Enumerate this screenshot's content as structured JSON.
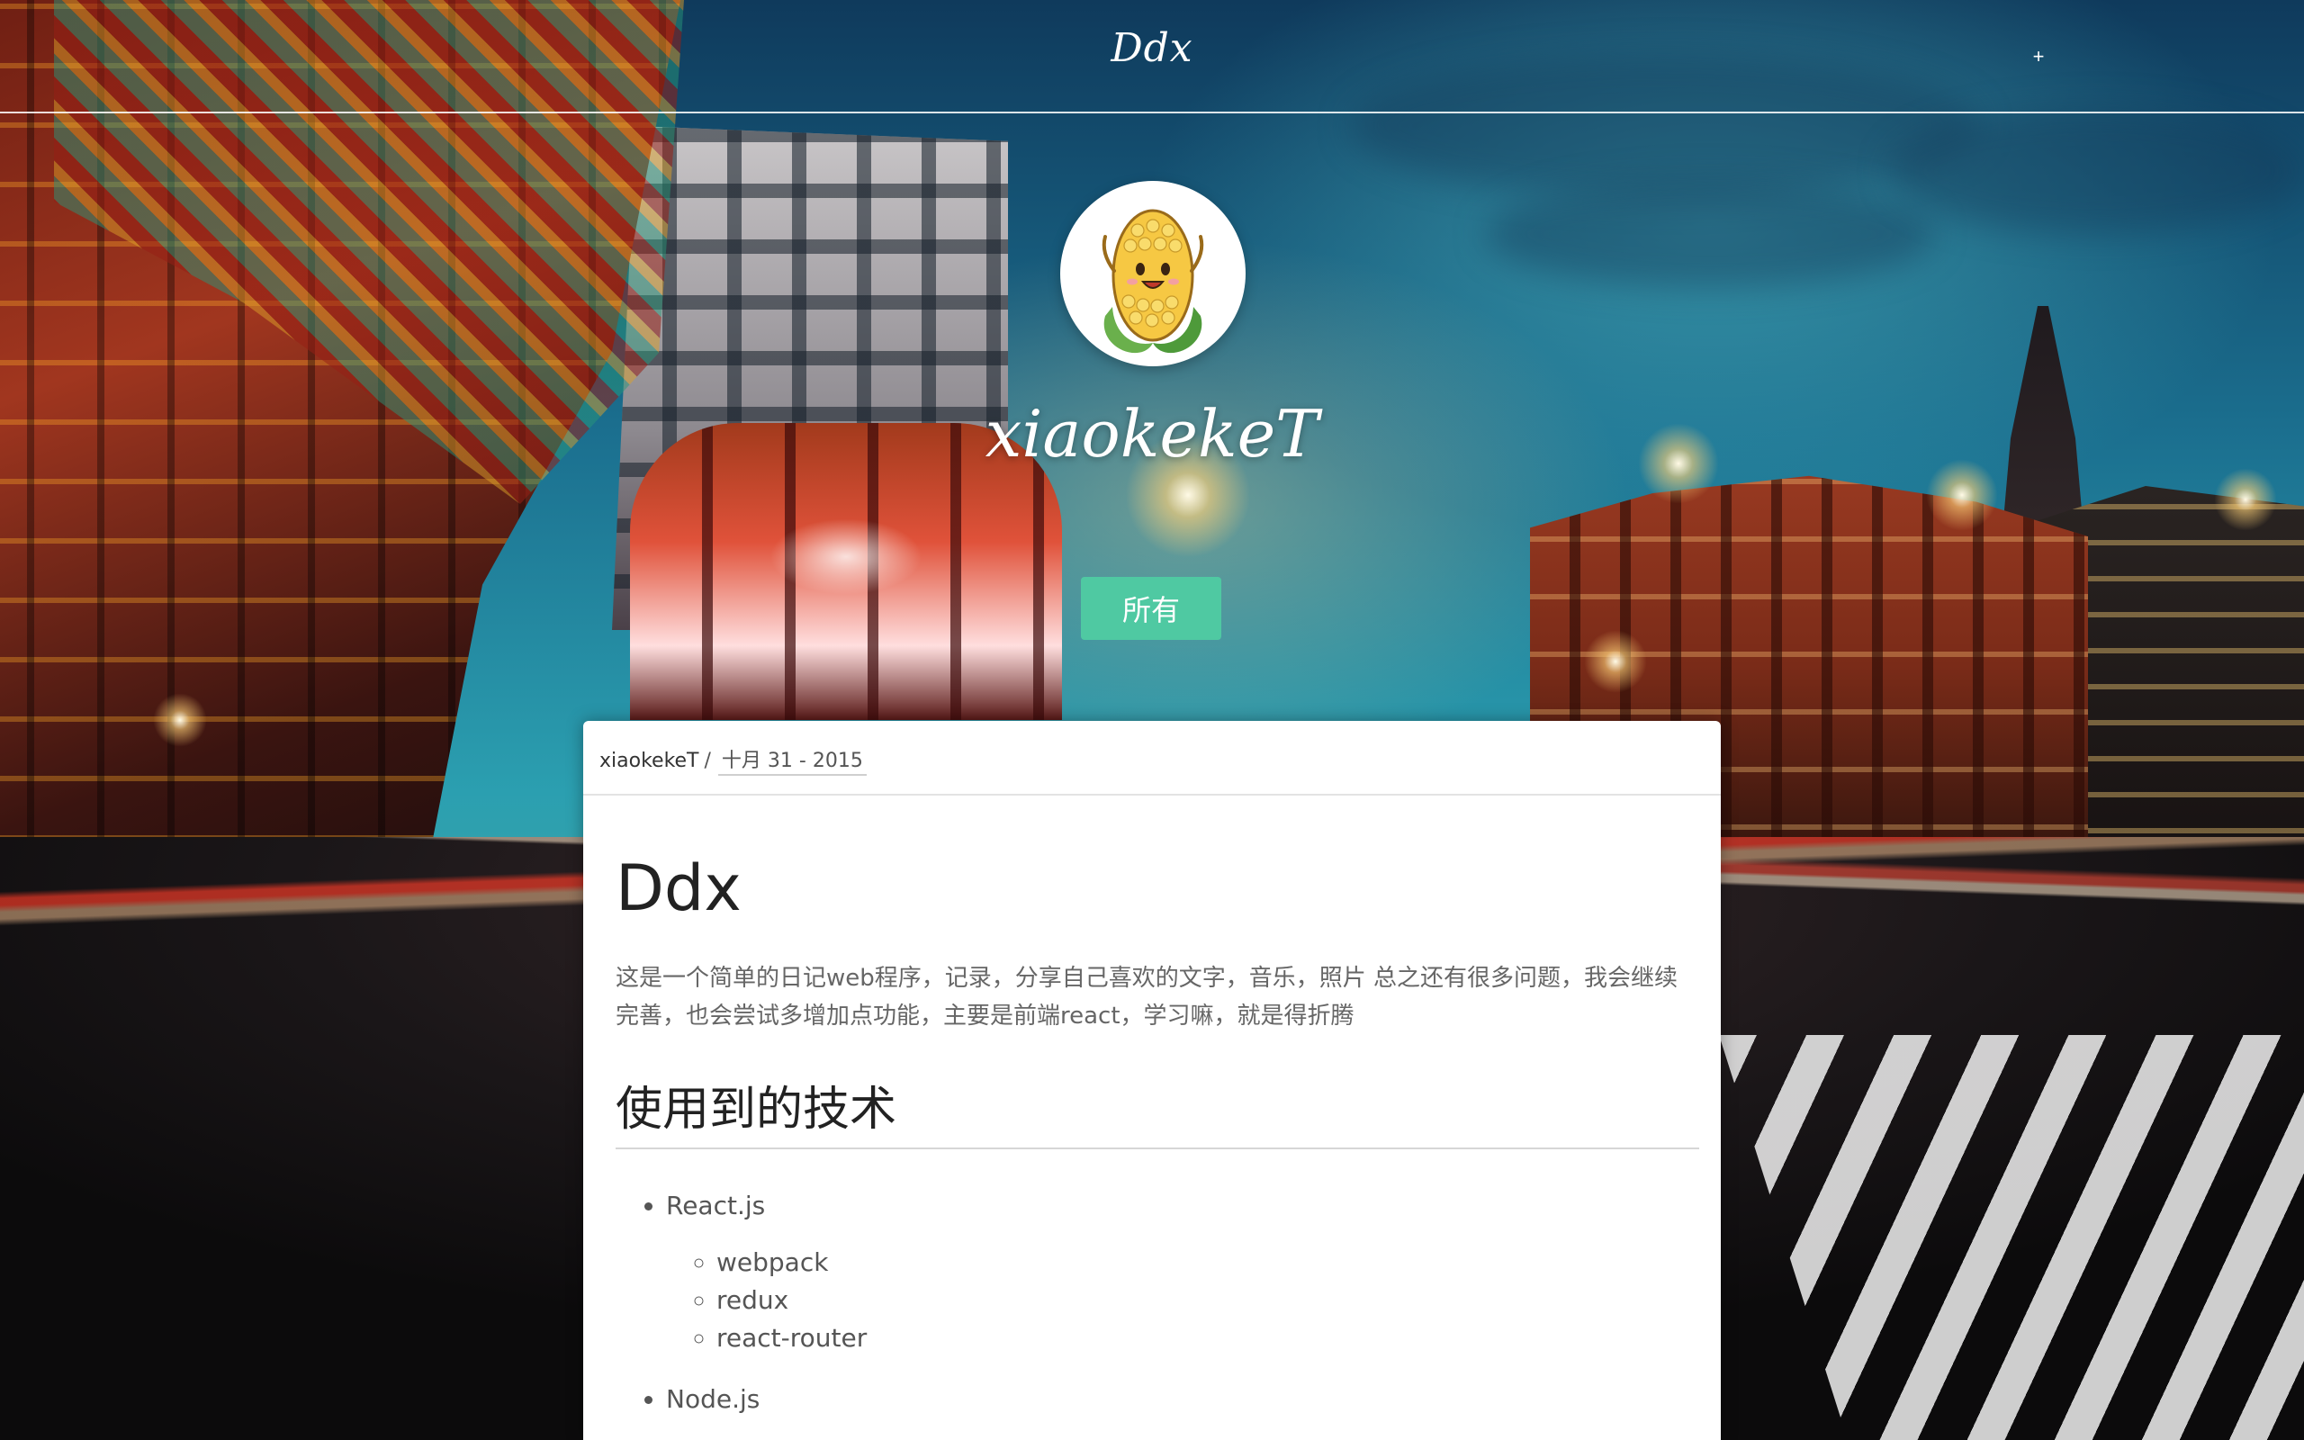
{
  "header": {
    "site_title": "Ddx",
    "add_button_label": "+"
  },
  "profile": {
    "avatar_icon": "corn-mascot-icon",
    "username": "xiaokekeT",
    "filter_button_label": "所有"
  },
  "post": {
    "author": "xiaokekeT",
    "separator": "/",
    "date": "十月 31 - 2015",
    "title": "Ddx",
    "paragraph": "这是一个简单的日记web程序，记录，分享自己喜欢的文字，音乐，照片 总之还有很多问题，我会继续完善，也会尝试多增加点功能，主要是前端react，学习嘛，就是得折腾",
    "section_heading": "使用到的技术",
    "tech_list": [
      {
        "label": "React.js",
        "children": [
          "webpack",
          "redux",
          "react-router"
        ]
      },
      {
        "label": "Node.js",
        "children": []
      }
    ]
  },
  "colors": {
    "accent_button": "#4fc9a2",
    "card_background": "#ffffff",
    "header_text": "#ffffff"
  }
}
